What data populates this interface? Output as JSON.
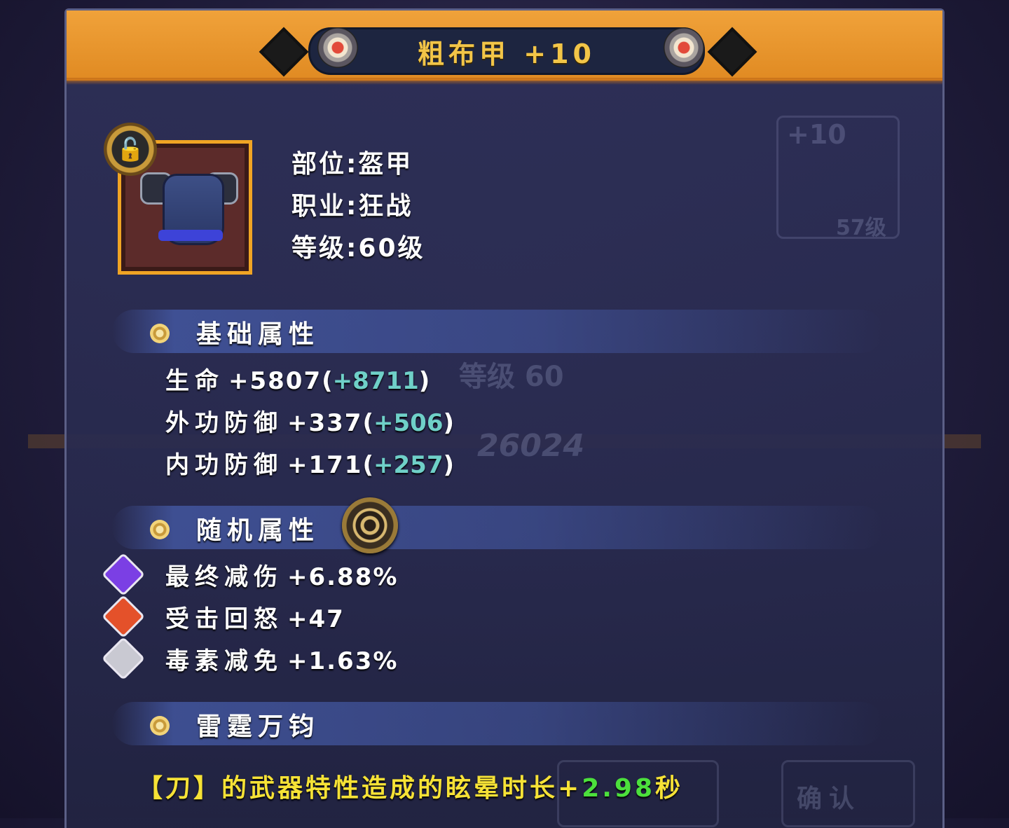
{
  "header": {
    "title": "粗布甲 +10"
  },
  "item": {
    "icon": "armor-icon",
    "lock_icon": "unlock-icon",
    "slot": "部位:盔甲",
    "class": "职业:狂战",
    "level": "等级:60级"
  },
  "base_section": {
    "title": "基础属性",
    "stats": [
      {
        "name": "生命",
        "value": "+5807",
        "bonus": "+8711"
      },
      {
        "name": "外功防御",
        "value": "+337",
        "bonus": "+506"
      },
      {
        "name": "内功防御",
        "value": "+171",
        "bonus": "+257"
      }
    ]
  },
  "random_section": {
    "title": "随机属性",
    "eye_icon": "eye-icon",
    "stats": [
      {
        "name": "最终减伤",
        "value": "+6.88%",
        "gem": "purple-gem-icon",
        "gem_color": "#7b3fe4"
      },
      {
        "name": "受击回怒",
        "value": "+47",
        "gem": "red-gem-icon",
        "gem_color": "#e4512a"
      },
      {
        "name": "毒素减免",
        "value": "+1.63%",
        "gem": "silver-gem-icon",
        "gem_color": "#c9c9d2"
      }
    ]
  },
  "special_section": {
    "title": "雷霆万钧",
    "desc_prefix": "【刀】的武器特性造成的眩晕时长",
    "desc_plus": "+",
    "desc_value": "2.98",
    "desc_unit": "秒"
  },
  "background": {
    "ghost_level": "等级 60",
    "ghost_power": "26024",
    "ghost_plus10": "+10",
    "ghost_57": "57级",
    "ghost_confirm": "确认"
  },
  "colors": {
    "header": "#e8962c",
    "title": "#f2c548",
    "bonus": "#6fd0c8",
    "desc_yellow": "#f6e236",
    "desc_green": "#4ce03c"
  }
}
